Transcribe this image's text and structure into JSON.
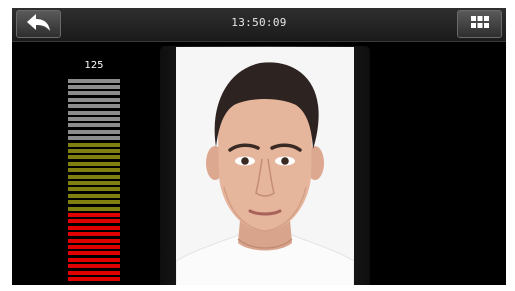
{
  "header": {
    "time": "13:50:09",
    "back_icon": "back-arrow-icon",
    "menu_icon": "grid-menu-icon"
  },
  "level_meter": {
    "value": "125",
    "segments_total": 32,
    "level_fraction": 1.0,
    "zones": [
      {
        "name": "low",
        "count": 11,
        "color": "#e00000"
      },
      {
        "name": "mid",
        "count": 11,
        "color": "#808010"
      },
      {
        "name": "high",
        "count": 10,
        "color": "#8c8c8c"
      }
    ]
  },
  "photo": {
    "subject": "face-portrait",
    "background_color": "#f6f6f6"
  },
  "colors": {
    "screen_background": "#000000",
    "topbar": "#1f1f1f",
    "button": "#454545"
  }
}
